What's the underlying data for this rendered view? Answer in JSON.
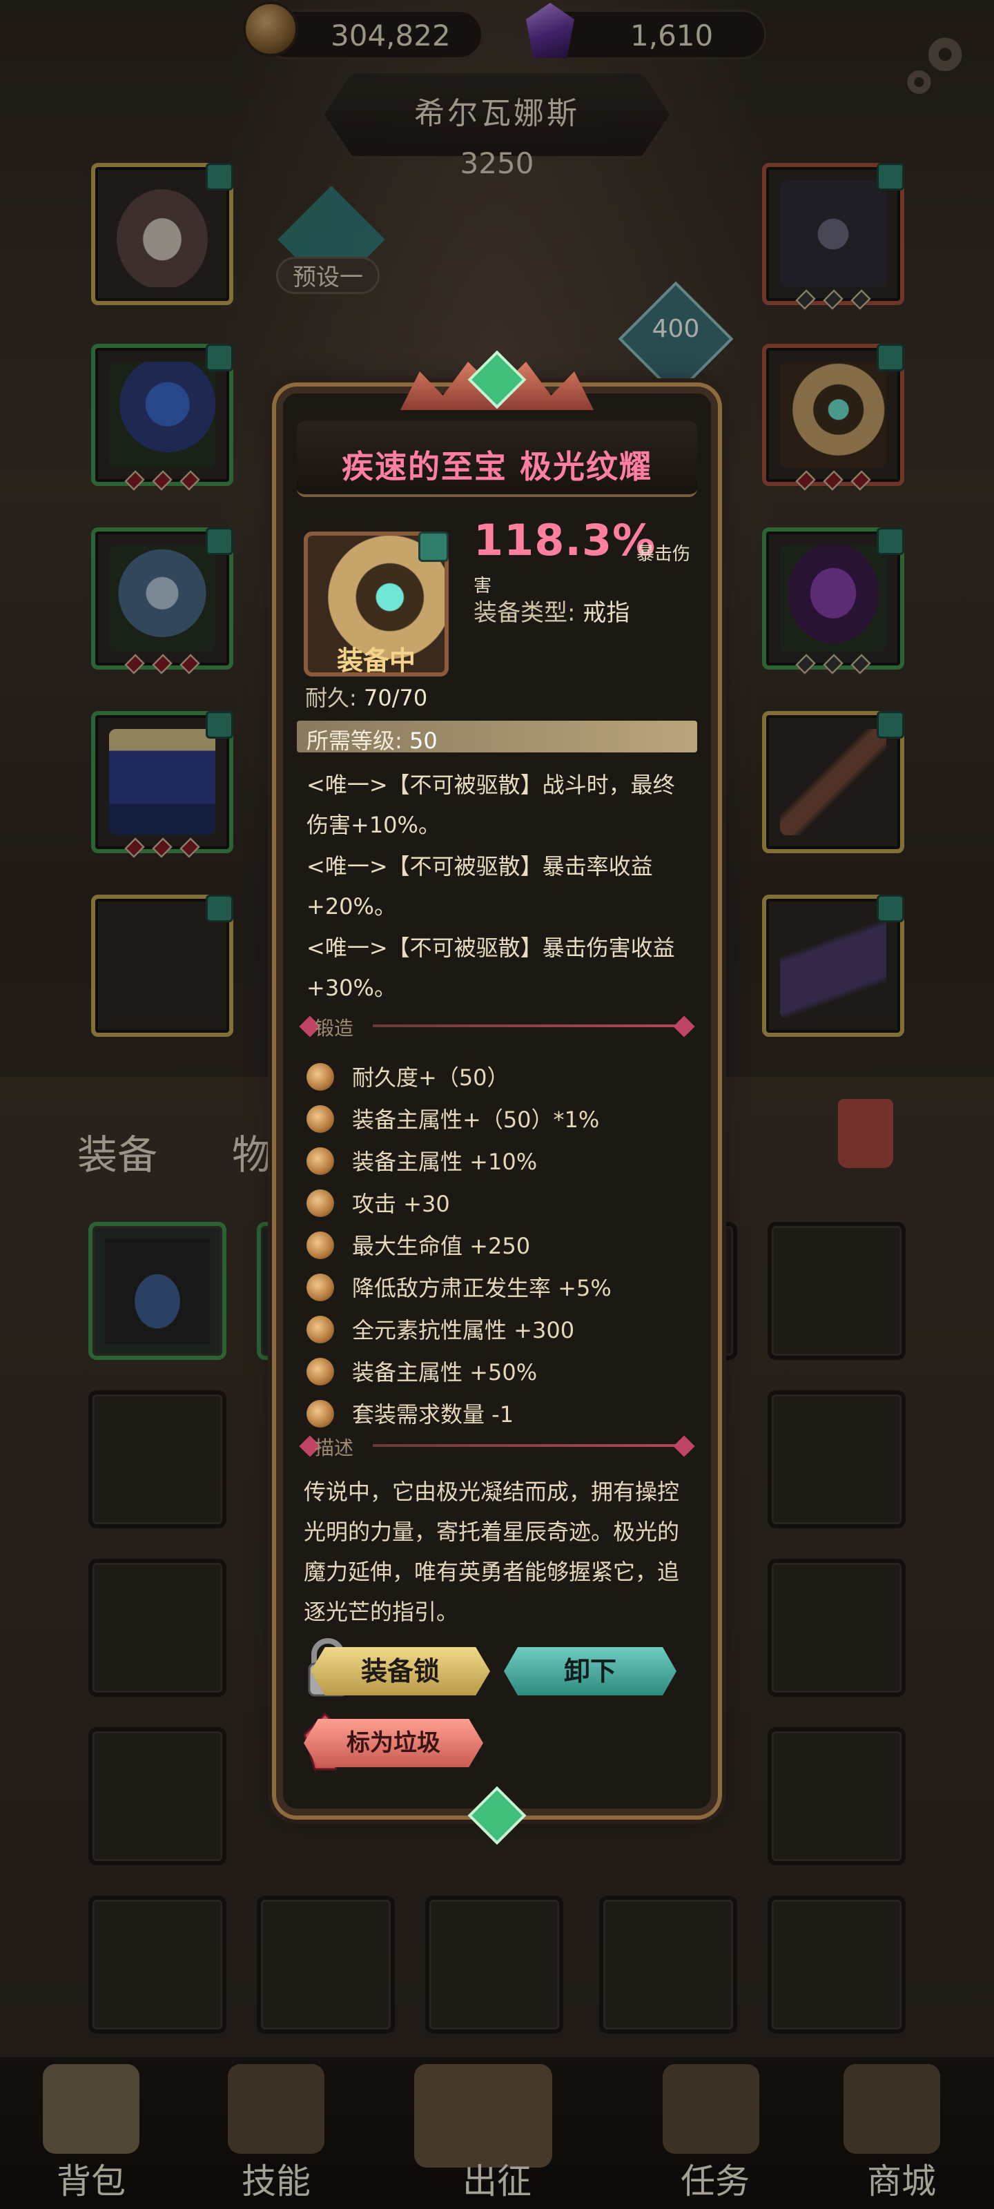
{
  "top_bar": {
    "gold": "304,822",
    "gems": "1,610",
    "settings_icon": "gear-icon"
  },
  "hero": {
    "name": "希尔瓦娜斯",
    "power": "3250",
    "preset": "预设一",
    "preset_power": "400"
  },
  "bag": {
    "tabs": [
      "装备",
      "物品"
    ],
    "trash_icon": "trash-icon"
  },
  "bottom_nav": [
    "背包",
    "技能",
    "出征",
    "任务",
    "商城"
  ],
  "tooltip": {
    "title": "疾速的至宝 极光纹耀",
    "stat_value": "118.3%",
    "stat_name_part1": "暴击伤",
    "stat_name_part2": "害",
    "equip_type_label": "装备类型:",
    "equip_type_value": "戒指",
    "equipped_label": "装备中",
    "durability_label": "耐久:",
    "durability_value": "70/70",
    "level_label": "所需等级:",
    "level_value": "50",
    "effects": [
      "<唯一>【不可被驱散】战斗时，最终",
      "伤害+10%。",
      "<唯一>【不可被驱散】暴击率收益",
      "+20%。",
      "<唯一>【不可被驱散】暴击伤害收益",
      "+30%。"
    ],
    "forge_label": "锻造",
    "forge_list": [
      "耐久度+（50）",
      "装备主属性+（50）*1%",
      "装备主属性 +10%",
      "攻击 +30",
      "最大生命值 +250",
      "降低敌方肃正发生率 +5%",
      "全元素抗性属性 +300",
      "装备主属性 +50%",
      "套装需求数量 -1"
    ],
    "desc_label": "描述",
    "description": "传说中，它由极光凝结而成，拥有操控光明的力量，寄托着星辰奇迹。极光的魔力延伸，唯有英勇者能够握紧它，追逐光芒的指引。",
    "buttons": {
      "lock": "装备锁",
      "unequip": "卸下",
      "junk": "标为垃圾"
    }
  }
}
